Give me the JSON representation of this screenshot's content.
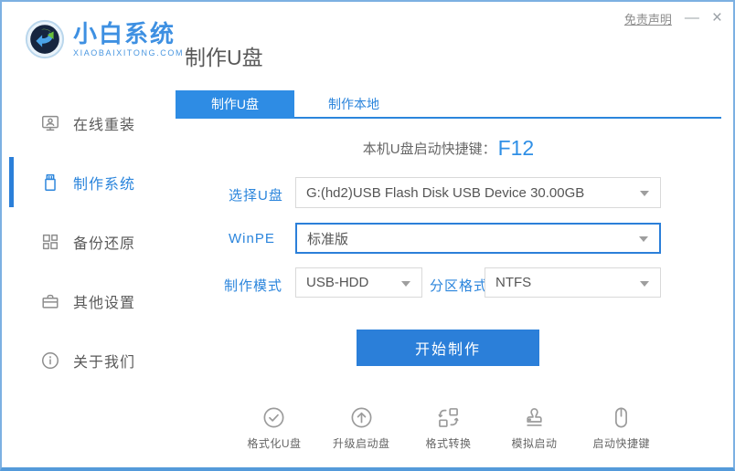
{
  "window": {
    "disclaimer": "免责声明",
    "minimize": "—",
    "close": "×"
  },
  "brand": {
    "name": "小白系统",
    "domain": "XIAOBAIXITONG.COM",
    "logo_icon": "sync-sphere-logo"
  },
  "header": {
    "title": "制作U盘"
  },
  "sidebar": {
    "items": [
      {
        "label": "在线重装",
        "icon": "monitor-reinstall-icon",
        "active": false
      },
      {
        "label": "制作系统",
        "icon": "usb-drive-icon",
        "active": true
      },
      {
        "label": "备份还原",
        "icon": "backup-restore-icon",
        "active": false
      },
      {
        "label": "其他设置",
        "icon": "settings-case-icon",
        "active": false
      },
      {
        "label": "关于我们",
        "icon": "info-icon",
        "active": false
      }
    ]
  },
  "tabs": [
    {
      "label": "制作U盘",
      "active": true
    },
    {
      "label": "制作本地",
      "active": false
    }
  ],
  "main": {
    "hotkey_prefix": "本机U盘启动快捷键：",
    "hotkey_value": "F12",
    "usb_label": "选择U盘",
    "usb_value": "G:(hd2)USB Flash Disk USB Device 30.00GB",
    "winpe_label": "WinPE",
    "winpe_value": "标准版",
    "mode_label": "制作模式",
    "mode_value": "USB-HDD",
    "partition_label": "分区格式",
    "partition_value": "NTFS",
    "start_button": "开始制作"
  },
  "tools": [
    {
      "label": "格式化U盘",
      "icon": "check-circle-icon"
    },
    {
      "label": "升级启动盘",
      "icon": "arrow-up-circle-icon"
    },
    {
      "label": "格式转换",
      "icon": "convert-icon"
    },
    {
      "label": "模拟启动",
      "icon": "stamp-icon"
    },
    {
      "label": "启动快捷键",
      "icon": "mouse-icon"
    }
  ],
  "colors": {
    "accent": "#2b85dc",
    "tab_active_bg": "#2e8ce4",
    "window_border": "#7cb0e2",
    "select_border": "#d9d9d9",
    "muted_text": "#666666",
    "icon_gray": "#9b9b9b"
  }
}
